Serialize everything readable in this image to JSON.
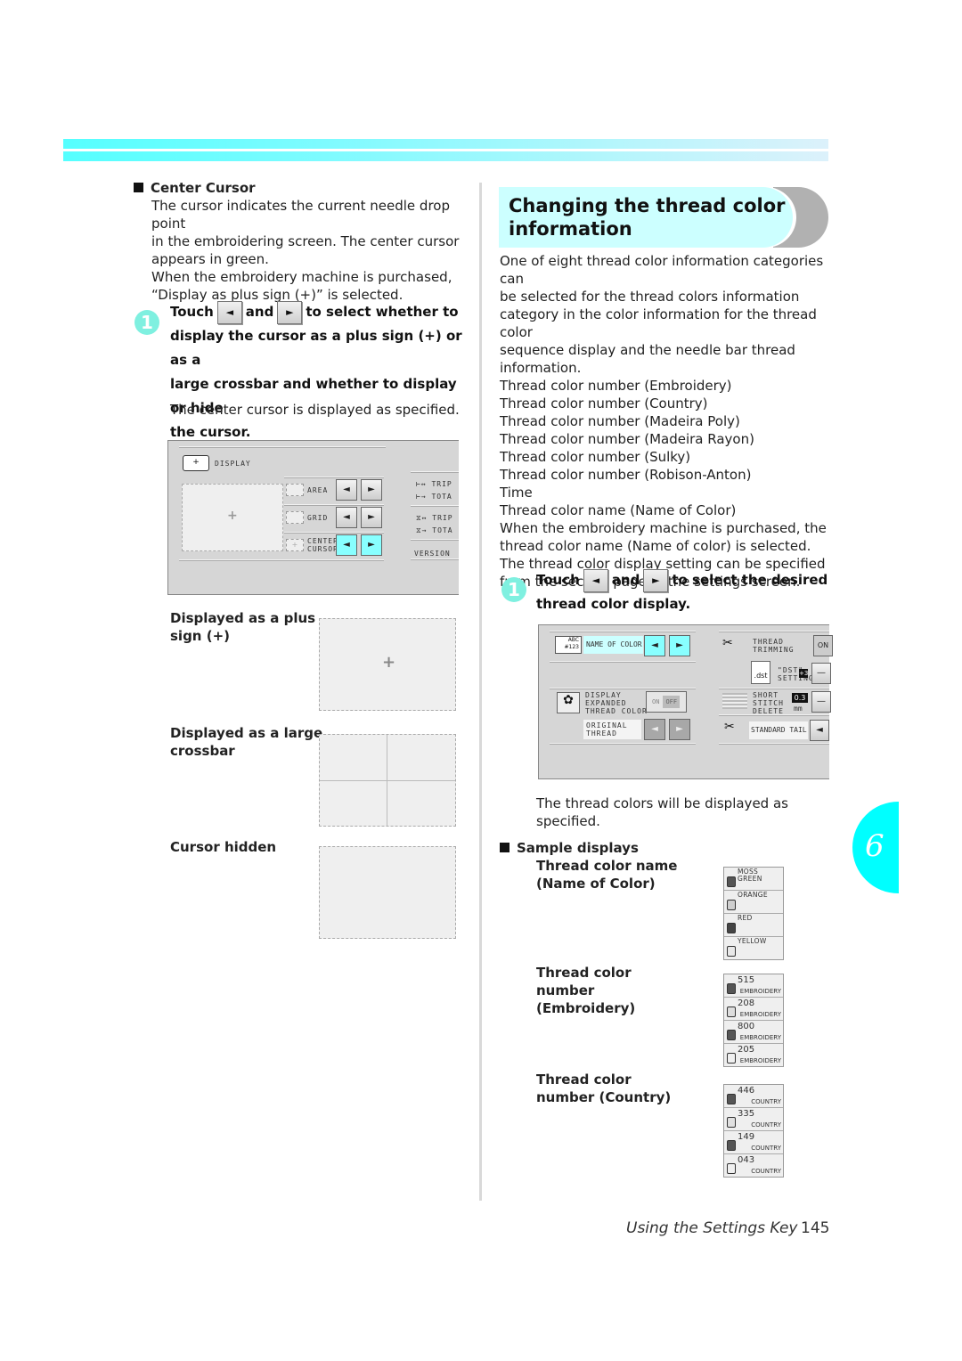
{
  "header_band": {
    "color_start": "#55ffff",
    "color_end": "#dcf1fb"
  },
  "left": {
    "section_title": "Center Cursor",
    "description": [
      "The cursor indicates the current needle drop point",
      "in the embroidering screen. The center cursor",
      "appears in green.",
      "When the embroidery machine is purchased,",
      "“Display as plus sign (+)” is selected."
    ],
    "step": {
      "number": "1",
      "touch": "Touch",
      "and": "and",
      "after": "to select whether to",
      "lines": [
        "display the cursor as a plus sign (+) or as a",
        "large crossbar and whether to display or hide",
        "the cursor."
      ],
      "left_arrow": "◄",
      "right_arrow": "►",
      "result": "The center cursor is displayed as specified."
    },
    "screen": {
      "display_label": "DISPLAY",
      "rows": [
        {
          "label": "AREA"
        },
        {
          "label": "GRID"
        },
        {
          "label": "CENTER CURSOR",
          "label_line1": "CENTER",
          "label_line2": "CURSOR",
          "active": true
        }
      ],
      "right_items": [
        "TRIP",
        "TOTA",
        "TRIP",
        "TOTA"
      ],
      "version": "VERSION",
      "left_arrow": "◄",
      "right_arrow": "►",
      "plus": "+"
    },
    "examples": [
      {
        "label_l1": "Displayed as a plus",
        "label_l2": "sign (+)",
        "mode": "plus",
        "glyph": "+"
      },
      {
        "label_l1": "Displayed as a large",
        "label_l2": "crossbar",
        "mode": "crossbar"
      },
      {
        "label_l1": "Cursor hidden",
        "label_l2": "",
        "mode": "hidden"
      }
    ]
  },
  "right": {
    "heading_l1": "Changing the thread color",
    "heading_l2": "information",
    "heading_bg": "#ccffff",
    "intro": [
      "One of eight thread color information categories can",
      "be selected for the thread colors information",
      "category in the color information for the thread color",
      "sequence display and the needle bar thread",
      "information."
    ],
    "categories": [
      "Thread color number (Embroidery)",
      "Thread color number (Country)",
      "Thread color number (Madeira Poly)",
      "Thread color number (Madeira Rayon)",
      "Thread color number (Sulky)",
      "Thread color number (Robison-Anton)",
      "Time",
      "Thread color name (Name of Color)"
    ],
    "after": [
      "When the embroidery machine is purchased, the",
      "thread color name (Name of color) is selected.",
      "The thread color display setting can be specified",
      "from the second page of the settings screen."
    ],
    "step": {
      "number": "1",
      "touch": "Touch",
      "and": "and",
      "after": "to select the desired",
      "line2": "thread color display.",
      "left_arrow": "◄",
      "right_arrow": "►",
      "result_l1": "The thread colors will be displayed as",
      "result_l2": "specified."
    },
    "screen": {
      "name_of_color": "NAME OF COLOR",
      "abc_icon": "ABC #123",
      "display_expanded": [
        "DISPLAY",
        "EXPANDED",
        "THREAD COLOR"
      ],
      "on": "ON",
      "off": "OFF",
      "original_thread": [
        "ORIGINAL",
        "THREAD"
      ],
      "thread_trimming": [
        "THREAD",
        "TRIMMING"
      ],
      "thread_trimming_value": "ON",
      "dst_setting": [
        "\"DST\"",
        "SETTING"
      ],
      "dst_value": "+3",
      "dst_file": ".dst",
      "short_stitch": [
        "SHORT",
        "STITCH",
        "DELETE"
      ],
      "short_stitch_value": "0.3",
      "short_stitch_unit": "mm",
      "standard_tail": "STANDARD TAIL",
      "minus": "—",
      "left_arrow": "◄",
      "right_arrow": "►"
    },
    "samples_title": "Sample displays",
    "samples": [
      {
        "label": [
          "Thread color name",
          "(Name of Color)"
        ],
        "type": "name",
        "items": [
          {
            "name_l1": "MOSS",
            "name_l2": "GREEN",
            "spool": "#555555"
          },
          {
            "name_l1": "ORANGE",
            "name_l2": "",
            "spool": "#cfcfcf"
          },
          {
            "name_l1": "RED",
            "name_l2": "",
            "spool": "#444444"
          },
          {
            "name_l1": "YELLOW",
            "name_l2": "",
            "spool": "#e8e8e8"
          }
        ]
      },
      {
        "label": [
          "Thread color",
          "number",
          "(Embroidery)"
        ],
        "type": "number",
        "items": [
          {
            "number": "515",
            "sub": "EMBROIDERY",
            "spool": "#555555"
          },
          {
            "number": "208",
            "sub": "EMBROIDERY",
            "spool": "#dddddd"
          },
          {
            "number": "800",
            "sub": "EMBROIDERY",
            "spool": "#555555"
          },
          {
            "number": "205",
            "sub": "EMBROIDERY",
            "spool": "#f0f0f0"
          }
        ]
      },
      {
        "label": [
          "Thread color",
          "number (Country)"
        ],
        "type": "number",
        "items": [
          {
            "number": "446",
            "sub": "COUNTRY",
            "spool": "#555555"
          },
          {
            "number": "335",
            "sub": "COUNTRY",
            "spool": "#e0e0e0"
          },
          {
            "number": "149",
            "sub": "COUNTRY",
            "spool": "#555555"
          },
          {
            "number": "043",
            "sub": "COUNTRY",
            "spool": "#f0f0f0"
          }
        ]
      }
    ]
  },
  "chapter_tab": {
    "number": "6",
    "color": "#00ffff"
  },
  "footer": {
    "section": "Using the Settings Key",
    "page": "145"
  }
}
